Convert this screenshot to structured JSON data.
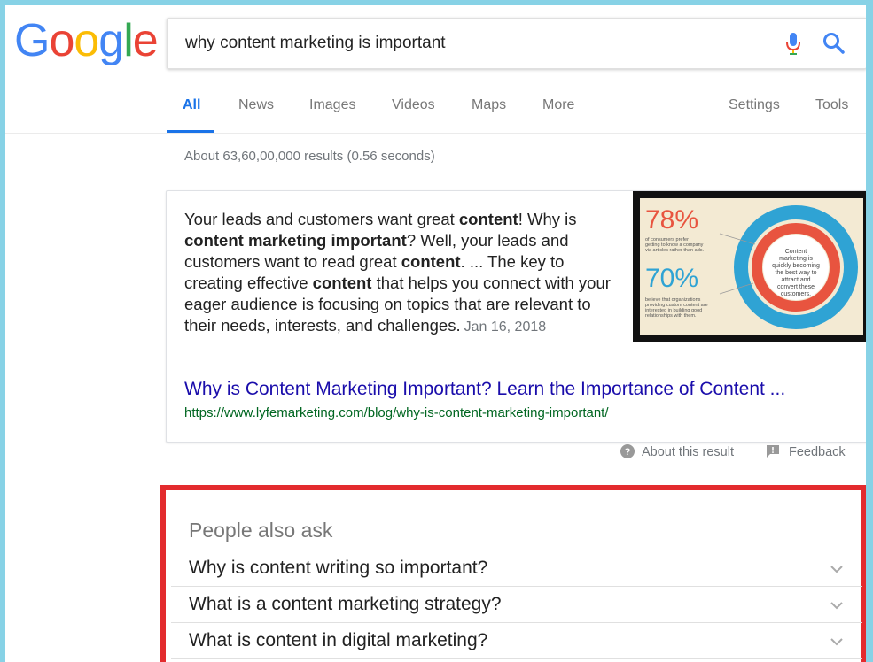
{
  "logo": {
    "letters": [
      "G",
      "o",
      "o",
      "g",
      "l",
      "e"
    ],
    "colors": [
      "#4285f4",
      "#ea4335",
      "#fbbc05",
      "#4285f4",
      "#34a853",
      "#ea4335"
    ]
  },
  "search": {
    "query": "why content marketing is important"
  },
  "tabs": {
    "items": [
      "All",
      "News",
      "Images",
      "Videos",
      "Maps",
      "More"
    ],
    "active": "All",
    "settings": "Settings",
    "tools": "Tools"
  },
  "stats": "About 63,60,00,000 results (0.56 seconds)",
  "featured": {
    "snippet_parts": [
      {
        "t": "Your leads and customers want great ",
        "b": false
      },
      {
        "t": "content",
        "b": true
      },
      {
        "t": "! Why is ",
        "b": false
      },
      {
        "t": "content marketing important",
        "b": true
      },
      {
        "t": "? Well, your leads and customers want to read great ",
        "b": false
      },
      {
        "t": "content",
        "b": true
      },
      {
        "t": ". ... The key to creating effective ",
        "b": false
      },
      {
        "t": "content",
        "b": true
      },
      {
        "t": " that helps you connect with your eager audience is focusing on topics that are relevant to their needs, interests, and challenges.",
        "b": false
      }
    ],
    "date": "Jan 16, 2018",
    "title": "Why is Content Marketing Important? Learn the Importance of Content ...",
    "url": "https://www.lyfemarketing.com/blog/why-is-content-marketing-important/",
    "image": {
      "stat1": "78%",
      "stat1_text": "of consumers prefer getting to know a company via articles rather than ads.",
      "stat2": "70%",
      "stat2_text": "believe that organizations providing custom content are interested in building good relationships with them.",
      "center_text": "Content marketing is quickly becoming the best way to attract and convert these customers.",
      "accent": "#e8543f",
      "ring": "#2fa3d4"
    }
  },
  "meta": {
    "about": "About this result",
    "feedback": "Feedback"
  },
  "people_also_ask": {
    "title": "People also ask",
    "questions": [
      "Why is content writing so important?",
      "What is a content marketing strategy?",
      "What is content in digital marketing?"
    ],
    "highlight_color": "#e32b2e"
  }
}
